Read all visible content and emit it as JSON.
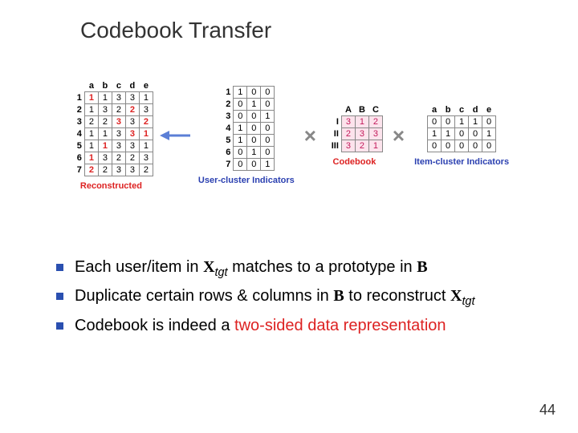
{
  "title": "Codebook Transfer",
  "page": "44",
  "reconstructed": {
    "label": "Reconstructed",
    "cols": [
      "a",
      "b",
      "c",
      "d",
      "e"
    ],
    "rows": [
      "1",
      "2",
      "3",
      "4",
      "5",
      "6",
      "7"
    ],
    "cells": [
      [
        {
          "v": "1",
          "h": true
        },
        {
          "v": "1"
        },
        {
          "v": "3"
        },
        {
          "v": "3"
        },
        {
          "v": "1"
        }
      ],
      [
        {
          "v": "1"
        },
        {
          "v": "3"
        },
        {
          "v": "2"
        },
        {
          "v": "2",
          "h": true
        },
        {
          "v": "3"
        }
      ],
      [
        {
          "v": "2"
        },
        {
          "v": "2"
        },
        {
          "v": "3",
          "h": true
        },
        {
          "v": "3"
        },
        {
          "v": "2",
          "h": true
        }
      ],
      [
        {
          "v": "1"
        },
        {
          "v": "1"
        },
        {
          "v": "3"
        },
        {
          "v": "3",
          "h": true
        },
        {
          "v": "1",
          "h": true
        }
      ],
      [
        {
          "v": "1"
        },
        {
          "v": "1",
          "h": true
        },
        {
          "v": "3"
        },
        {
          "v": "3"
        },
        {
          "v": "1"
        }
      ],
      [
        {
          "v": "1",
          "h": true
        },
        {
          "v": "3"
        },
        {
          "v": "2"
        },
        {
          "v": "2"
        },
        {
          "v": "3"
        }
      ],
      [
        {
          "v": "2",
          "h": true
        },
        {
          "v": "2"
        },
        {
          "v": "3"
        },
        {
          "v": "3"
        },
        {
          "v": "2"
        }
      ]
    ]
  },
  "user_indicators": {
    "label": "User-cluster Indicators",
    "rows": [
      "1",
      "2",
      "3",
      "4",
      "5",
      "6",
      "7"
    ],
    "cells": [
      [
        "1",
        "0",
        "0"
      ],
      [
        "0",
        "1",
        "0"
      ],
      [
        "0",
        "0",
        "1"
      ],
      [
        "1",
        "0",
        "0"
      ],
      [
        "1",
        "0",
        "0"
      ],
      [
        "0",
        "1",
        "0"
      ],
      [
        "0",
        "0",
        "1"
      ]
    ]
  },
  "codebook": {
    "label": "Codebook",
    "cols": [
      "A",
      "B",
      "C"
    ],
    "rows": [
      "I",
      "II",
      "III"
    ],
    "cells": [
      [
        "3",
        "1",
        "2"
      ],
      [
        "2",
        "3",
        "3"
      ],
      [
        "3",
        "2",
        "1"
      ]
    ]
  },
  "item_indicators": {
    "label": "Item-cluster Indicators",
    "cols": [
      "a",
      "b",
      "c",
      "d",
      "e"
    ],
    "cells": [
      [
        "0",
        "0",
        "1",
        "1",
        "0"
      ],
      [
        "1",
        "1",
        "0",
        "0",
        "1"
      ],
      [
        "0",
        "0",
        "0",
        "0",
        "0"
      ]
    ]
  },
  "bullets": {
    "b1_a": "Each user/item in ",
    "b1_x": "X",
    "b1_tgt": "tgt",
    "b1_b": " matches to a prototype in ",
    "b1_B": "B",
    "b2_a": "Duplicate certain rows & columns in ",
    "b2_B": "B",
    "b2_b": " to reconstruct ",
    "b2_x": "X",
    "b2_tgt": "tgt",
    "b3_a": "Codebook is indeed a ",
    "b3_red": "two-sided data representation"
  },
  "chart_data": [
    {
      "type": "table",
      "title": "Reconstructed",
      "columns": [
        "a",
        "b",
        "c",
        "d",
        "e"
      ],
      "row_labels": [
        "1",
        "2",
        "3",
        "4",
        "5",
        "6",
        "7"
      ],
      "values": [
        [
          1,
          1,
          3,
          3,
          1
        ],
        [
          1,
          3,
          2,
          2,
          3
        ],
        [
          2,
          2,
          3,
          3,
          2
        ],
        [
          1,
          1,
          3,
          3,
          1
        ],
        [
          1,
          1,
          3,
          3,
          1
        ],
        [
          1,
          3,
          2,
          2,
          3
        ],
        [
          2,
          2,
          3,
          3,
          2
        ]
      ]
    },
    {
      "type": "table",
      "title": "User-cluster Indicators",
      "row_labels": [
        "1",
        "2",
        "3",
        "4",
        "5",
        "6",
        "7"
      ],
      "values": [
        [
          1,
          0,
          0
        ],
        [
          0,
          1,
          0
        ],
        [
          0,
          0,
          1
        ],
        [
          1,
          0,
          0
        ],
        [
          1,
          0,
          0
        ],
        [
          0,
          1,
          0
        ],
        [
          0,
          0,
          1
        ]
      ]
    },
    {
      "type": "table",
      "title": "Codebook",
      "columns": [
        "A",
        "B",
        "C"
      ],
      "row_labels": [
        "I",
        "II",
        "III"
      ],
      "values": [
        [
          3,
          1,
          2
        ],
        [
          2,
          3,
          3
        ],
        [
          3,
          2,
          1
        ]
      ]
    },
    {
      "type": "table",
      "title": "Item-cluster Indicators",
      "columns": [
        "a",
        "b",
        "c",
        "d",
        "e"
      ],
      "values": [
        [
          0,
          0,
          1,
          1,
          0
        ],
        [
          1,
          1,
          0,
          0,
          1
        ],
        [
          0,
          0,
          0,
          0,
          0
        ]
      ]
    }
  ]
}
